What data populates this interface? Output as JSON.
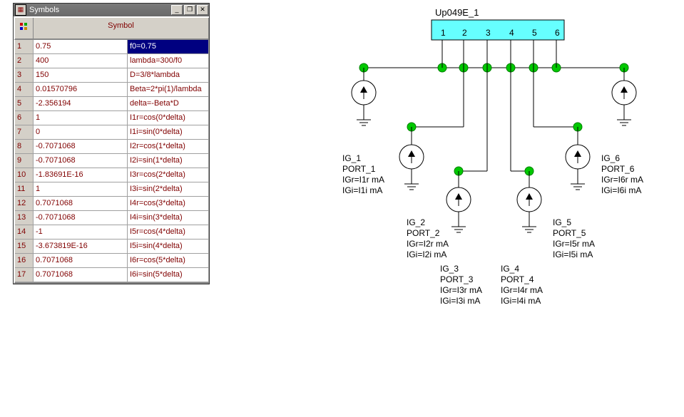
{
  "window": {
    "title": "Symbols",
    "buttons": {
      "min": "_",
      "max": "❐",
      "close": "✕"
    },
    "header": {
      "icon": "⚙",
      "symbol": "Symbol"
    }
  },
  "rows": [
    {
      "idx": "1",
      "val": "0.75",
      "expr": "f0=0.75",
      "selected": true
    },
    {
      "idx": "2",
      "val": "400",
      "expr": "lambda=300/f0"
    },
    {
      "idx": "3",
      "val": "150",
      "expr": "D=3/8*lambda"
    },
    {
      "idx": "4",
      "val": "0.01570796",
      "expr": "Beta=2*pi(1)/lambda"
    },
    {
      "idx": "5",
      "val": "-2.356194",
      "expr": "delta=-Beta*D"
    },
    {
      "idx": "6",
      "val": "1",
      "expr": "I1r=cos(0*delta)"
    },
    {
      "idx": "7",
      "val": "0",
      "expr": "I1i=sin(0*delta)"
    },
    {
      "idx": "8",
      "val": "-0.7071068",
      "expr": "I2r=cos(1*delta)"
    },
    {
      "idx": "9",
      "val": "-0.7071068",
      "expr": "I2i=sin(1*delta)"
    },
    {
      "idx": "10",
      "val": "-1.83691E-16",
      "expr": "I3r=cos(2*delta)"
    },
    {
      "idx": "11",
      "val": "1",
      "expr": "I3i=sin(2*delta)"
    },
    {
      "idx": "12",
      "val": "0.7071068",
      "expr": "I4r=cos(3*delta)"
    },
    {
      "idx": "13",
      "val": "-0.7071068",
      "expr": "I4i=sin(3*delta)"
    },
    {
      "idx": "14",
      "val": "-1",
      "expr": "I5r=cos(4*delta)"
    },
    {
      "idx": "15",
      "val": "-3.673819E-16",
      "expr": "I5i=sin(4*delta)"
    },
    {
      "idx": "16",
      "val": "0.7071068",
      "expr": "I6r=cos(5*delta)"
    },
    {
      "idx": "17",
      "val": "0.7071068",
      "expr": "I6i=sin(5*delta)"
    }
  ],
  "schematic": {
    "block": "Up049E_1",
    "ports": [
      "1",
      "2",
      "3",
      "4",
      "5",
      "6"
    ],
    "sources": [
      {
        "name": "IG_1",
        "port": "PORT_1",
        "igr": "IGr=I1r mA",
        "igi": "IGi=I1i mA"
      },
      {
        "name": "IG_2",
        "port": "PORT_2",
        "igr": "IGr=I2r mA",
        "igi": "IGi=I2i mA"
      },
      {
        "name": "IG_3",
        "port": "PORT_3",
        "igr": "IGr=I3r mA",
        "igi": "IGi=I3i mA"
      },
      {
        "name": "IG_4",
        "port": "PORT_4",
        "igr": "IGr=I4r mA",
        "igi": "IGi=I4i mA"
      },
      {
        "name": "IG_5",
        "port": "PORT_5",
        "igr": "IGr=I5r mA",
        "igi": "IGi=I5i mA"
      },
      {
        "name": "IG_6",
        "port": "PORT_6",
        "igr": "IGr=I6r mA",
        "igi": "IGi=I6i mA"
      }
    ]
  }
}
